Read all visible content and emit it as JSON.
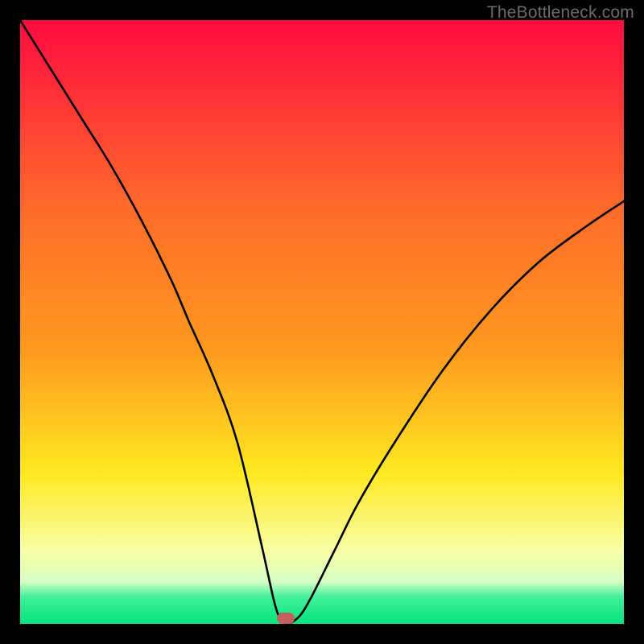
{
  "watermark": {
    "text": "TheBottleneck.com"
  },
  "chart_data": {
    "type": "line",
    "title": "",
    "xlabel": "",
    "ylabel": "",
    "xlim": [
      0,
      100
    ],
    "ylim": [
      0,
      100
    ],
    "grid": false,
    "legend": false,
    "background_gradient": {
      "top": "#ff0b40",
      "mid_upper": "#ff9a1f",
      "mid": "#ffe921",
      "mid_lower": "#f8ffa6",
      "green_band": "#42f09a",
      "bottom": "#07e37f"
    },
    "marker": {
      "x": 44,
      "y": 1,
      "color": "#c4605f"
    },
    "series": [
      {
        "name": "bottleneck-curve",
        "x": [
          0,
          5,
          10,
          15,
          20,
          25,
          28,
          32,
          36,
          40,
          42,
          43,
          44,
          46,
          48,
          52,
          56,
          62,
          70,
          78,
          86,
          94,
          100
        ],
        "y": [
          100,
          92,
          84,
          76,
          67,
          57,
          50,
          41,
          30,
          13,
          4,
          1,
          0,
          1,
          4,
          12,
          20,
          30,
          42,
          52,
          60,
          66,
          70
        ]
      }
    ]
  }
}
